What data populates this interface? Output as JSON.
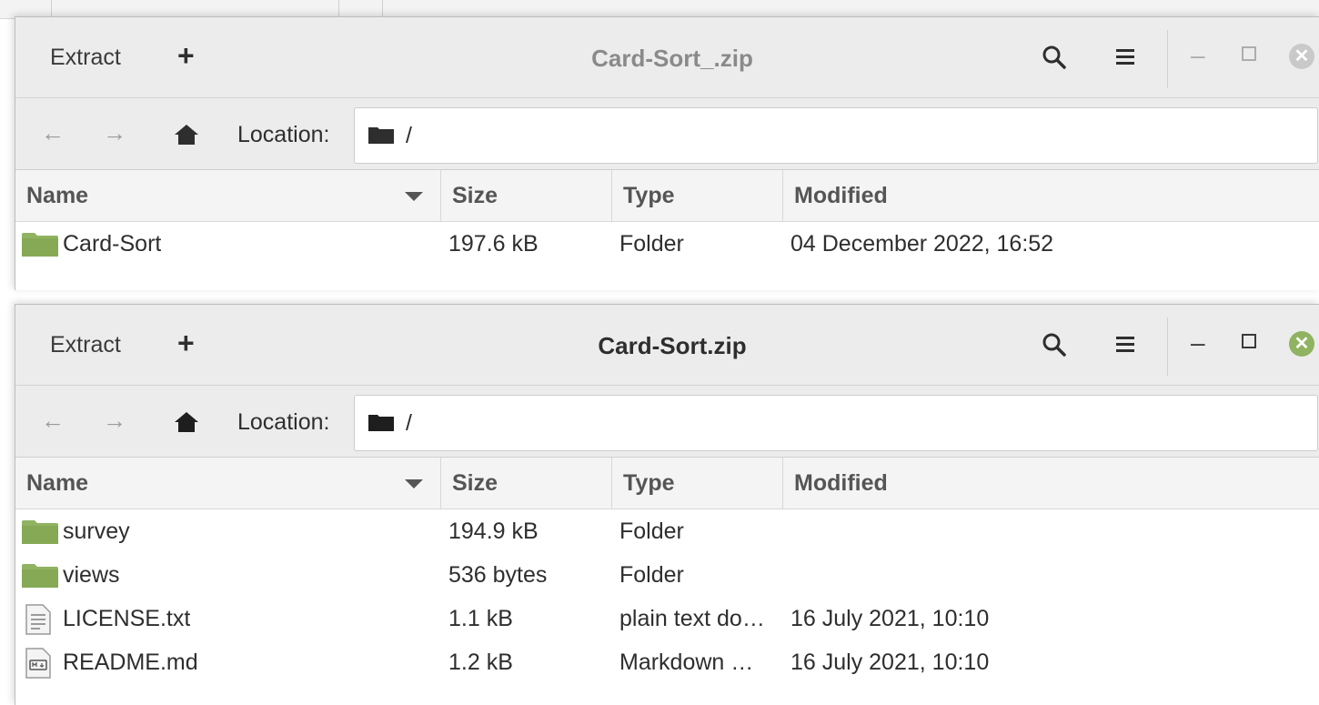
{
  "windows": [
    {
      "title": "Card-Sort_.zip",
      "extract_label": "Extract",
      "add_label": "+",
      "location_label": "Location:",
      "location_path": "/",
      "columns": {
        "name": "Name",
        "size": "Size",
        "type": "Type",
        "modified": "Modified"
      },
      "rows": [
        {
          "icon": "folder-icon",
          "name": "Card-Sort",
          "size": "197.6 kB",
          "type": "Folder",
          "modified": "04 December 2022, 16:52"
        }
      ]
    },
    {
      "title": "Card-Sort.zip",
      "extract_label": "Extract",
      "add_label": "+",
      "location_label": "Location:",
      "location_path": "/",
      "columns": {
        "name": "Name",
        "size": "Size",
        "type": "Type",
        "modified": "Modified"
      },
      "rows": [
        {
          "icon": "folder-icon",
          "name": "survey",
          "size": "194.9 kB",
          "type": "Folder",
          "modified": ""
        },
        {
          "icon": "folder-icon",
          "name": "views",
          "size": "536 bytes",
          "type": "Folder",
          "modified": ""
        },
        {
          "icon": "text-file-icon",
          "name": "LICENSE.txt",
          "size": "1.1 kB",
          "type": "plain text do…",
          "modified": "16 July 2021, 10:10"
        },
        {
          "icon": "markdown-file-icon",
          "name": "README.md",
          "size": "1.2 kB",
          "type": "Markdown …",
          "modified": "16 July 2021, 10:10"
        }
      ]
    }
  ],
  "colors": {
    "folder": "#8fb360",
    "close_active": "#8fb360",
    "titlebar": "#ececec"
  }
}
